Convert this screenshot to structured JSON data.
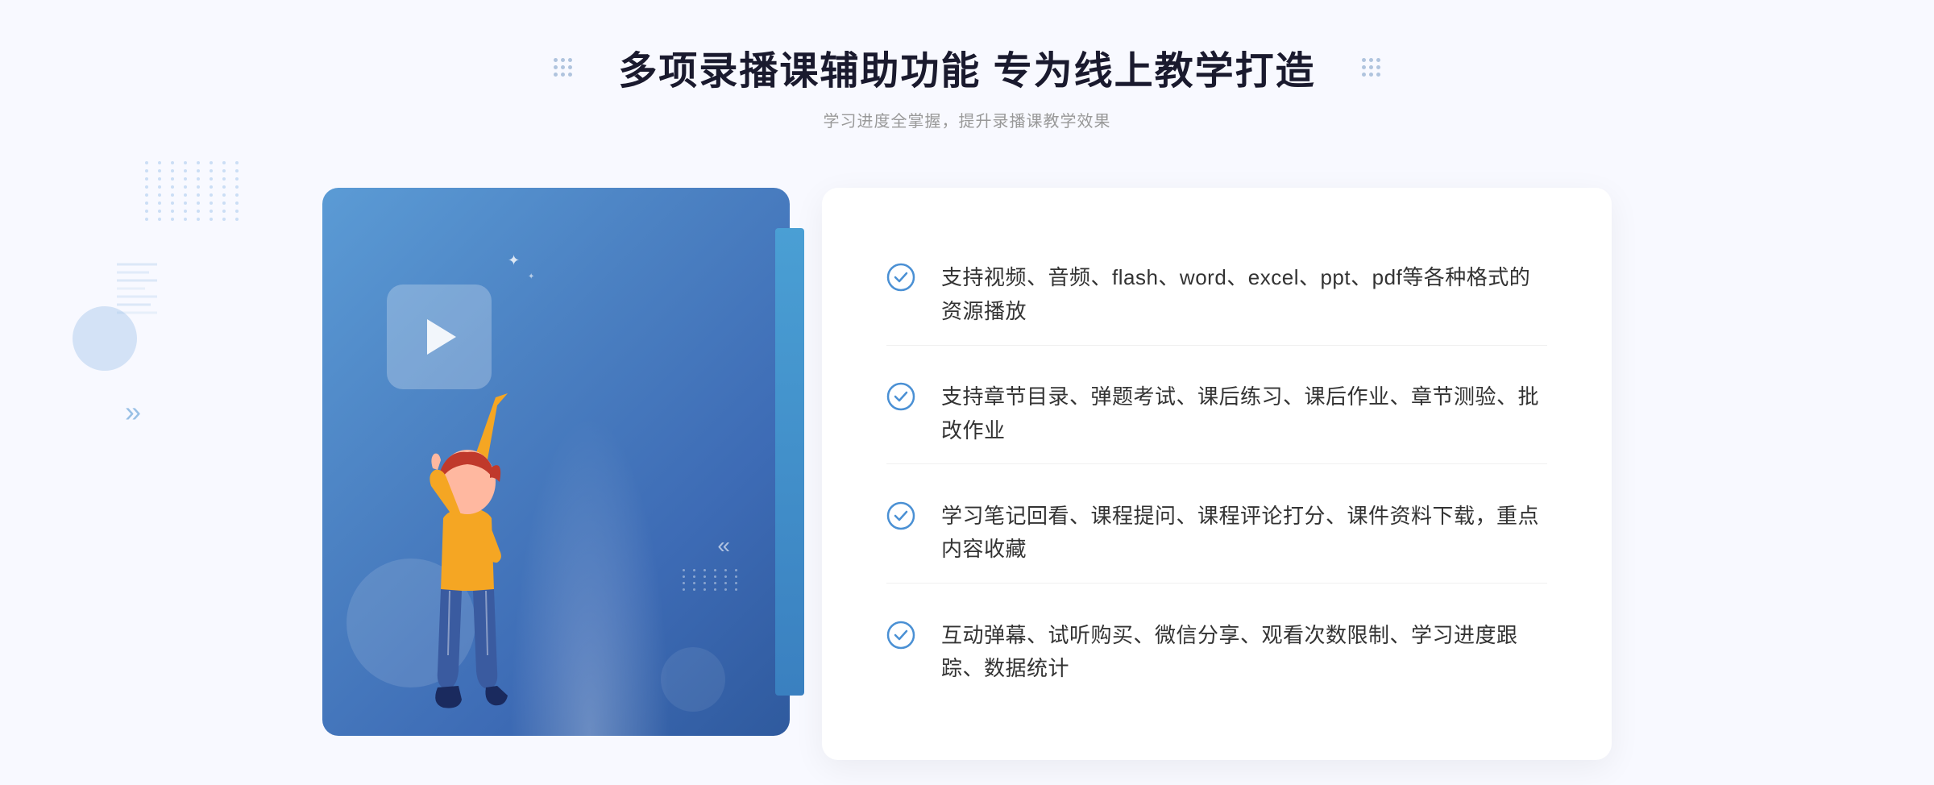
{
  "header": {
    "title": "多项录播课辅助功能 专为线上教学打造",
    "subtitle": "学习进度全掌握，提升录播课教学效果"
  },
  "features": [
    {
      "id": 1,
      "text": "支持视频、音频、flash、word、excel、ppt、pdf等各种格式的资源播放"
    },
    {
      "id": 2,
      "text": "支持章节目录、弹题考试、课后练习、课后作业、章节测验、批改作业"
    },
    {
      "id": 3,
      "text": "学习笔记回看、课程提问、课程评论打分、课件资料下载，重点内容收藏"
    },
    {
      "id": 4,
      "text": "互动弹幕、试听购买、微信分享、观看次数限制、学习进度跟踪、数据统计"
    }
  ],
  "icons": {
    "check": "check-circle-icon",
    "play": "play-icon",
    "chevron": "»"
  },
  "colors": {
    "primary": "#4a90d4",
    "accent": "#3d7fc0",
    "text_dark": "#1a1a2e",
    "text_gray": "#999999",
    "text_feature": "#333333"
  }
}
